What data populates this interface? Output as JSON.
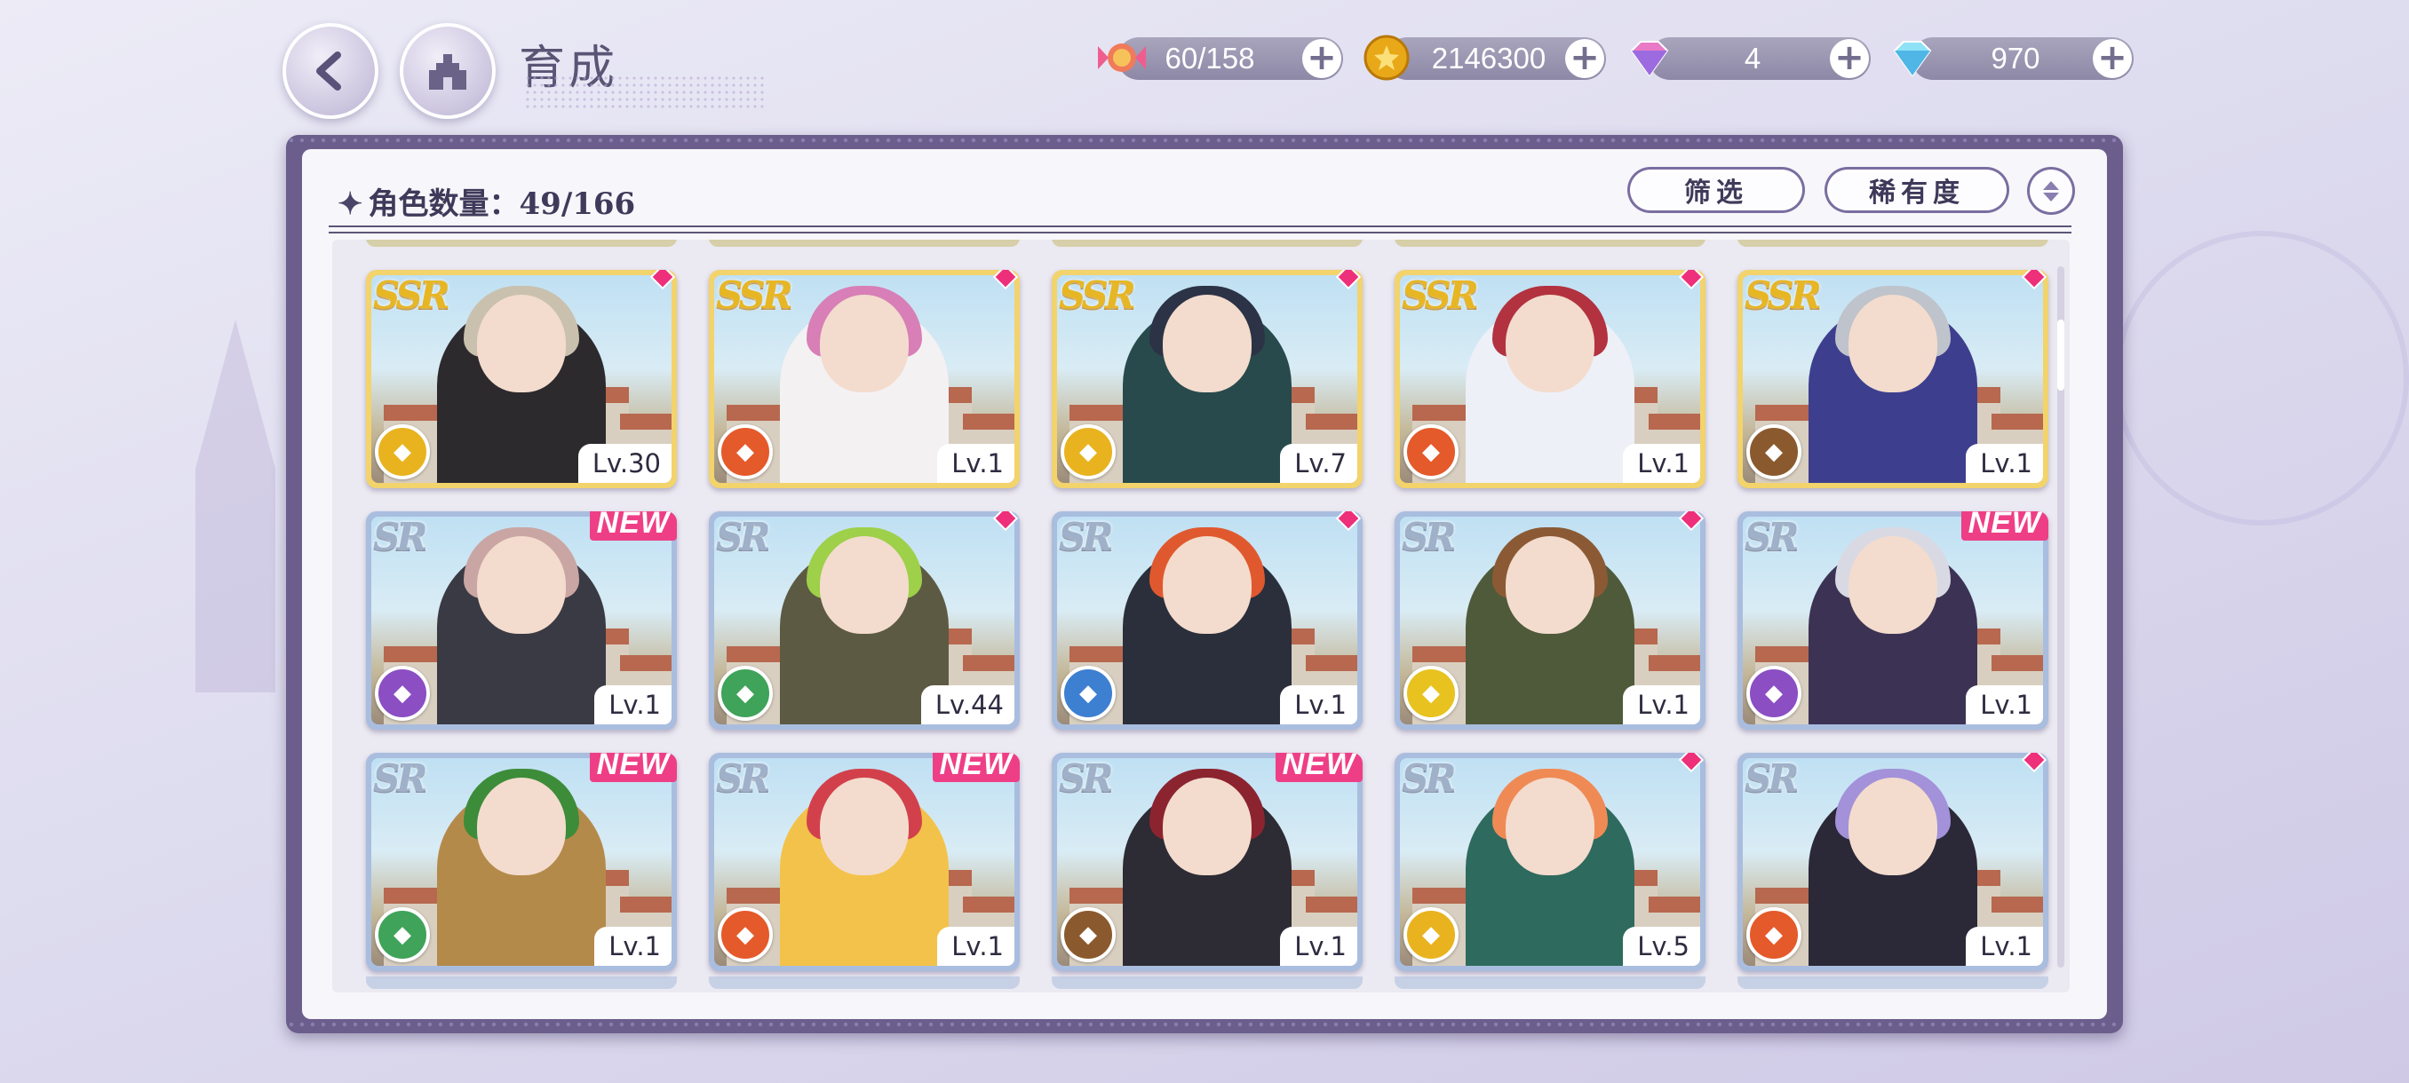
{
  "header": {
    "title": "育成",
    "back_icon": "back-arrow-icon",
    "home_icon": "castle-icon"
  },
  "resources": [
    {
      "name": "stamina",
      "icon": "candy-icon",
      "value": "60/158"
    },
    {
      "name": "gold",
      "icon": "gold-coin-icon",
      "value": "2146300"
    },
    {
      "name": "pink-gem",
      "icon": "pink-diamond-icon",
      "value": "4"
    },
    {
      "name": "blue-gem",
      "icon": "blue-diamond-icon",
      "value": "970"
    }
  ],
  "panel": {
    "count_label": "角色数量：",
    "count_value": "49/166",
    "filter_label": "筛选",
    "sort_label": "稀有度"
  },
  "cards": [
    {
      "rarity": "SSR",
      "level": "Lv.30",
      "element_color": "#e8b31f",
      "badge": "gem",
      "hair": "#c9c1ae",
      "outfit": "#2d2a2e"
    },
    {
      "rarity": "SSR",
      "level": "Lv.1",
      "element_color": "#e45a2a",
      "badge": "gem",
      "hair": "#d77fb6",
      "outfit": "#f4f1f3"
    },
    {
      "rarity": "SSR",
      "level": "Lv.7",
      "element_color": "#e8b31f",
      "badge": "gem",
      "hair": "#2c3346",
      "outfit": "#284a4c"
    },
    {
      "rarity": "SSR",
      "level": "Lv.1",
      "element_color": "#e45a2a",
      "badge": "gem",
      "hair": "#b3323f",
      "outfit": "#eef0f8"
    },
    {
      "rarity": "SSR",
      "level": "Lv.1",
      "element_color": "#8a5a2e",
      "badge": "gem",
      "hair": "#bfc3cb",
      "outfit": "#3d3f8e"
    },
    {
      "rarity": "SR",
      "level": "Lv.1",
      "element_color": "#8b4ec3",
      "badge": "NEW",
      "hair": "#c9a6a3",
      "outfit": "#3a3a44"
    },
    {
      "rarity": "SR",
      "level": "Lv.44",
      "element_color": "#3fa35a",
      "badge": "gem",
      "hair": "#9ed04a",
      "outfit": "#5d5a43"
    },
    {
      "rarity": "SR",
      "level": "Lv.1",
      "element_color": "#3d7fd1",
      "badge": "gem",
      "hair": "#e0592e",
      "outfit": "#2b2f3c"
    },
    {
      "rarity": "SR",
      "level": "Lv.1",
      "element_color": "#e8c21f",
      "badge": "gem",
      "hair": "#8b5a34",
      "outfit": "#4f5a3a"
    },
    {
      "rarity": "SR",
      "level": "Lv.1",
      "element_color": "#8b4ec3",
      "badge": "NEW",
      "hair": "#d9d9e3",
      "outfit": "#3c3354"
    },
    {
      "rarity": "SR",
      "level": "Lv.1",
      "element_color": "#3fa35a",
      "badge": "NEW",
      "hair": "#3d8c3a",
      "outfit": "#b48a4a"
    },
    {
      "rarity": "SR",
      "level": "Lv.1",
      "element_color": "#e45a2a",
      "badge": "NEW",
      "hair": "#d2414b",
      "outfit": "#f3c24a"
    },
    {
      "rarity": "SR",
      "level": "Lv.1",
      "element_color": "#8a5a2e",
      "badge": "NEW",
      "hair": "#8c2430",
      "outfit": "#2d2b33"
    },
    {
      "rarity": "SR",
      "level": "Lv.5",
      "element_color": "#e8b31f",
      "badge": "gem",
      "hair": "#f08a55",
      "outfit": "#2f6a5e"
    },
    {
      "rarity": "SR",
      "level": "Lv.1",
      "element_color": "#e45a2a",
      "badge": "gem",
      "hair": "#a391d9",
      "outfit": "#2b2838"
    }
  ],
  "colors": {
    "frame": "#6b5e8c",
    "new_badge": "#ee3f86",
    "ssr_border": "#f2d36c",
    "sr_border": "#a9bddf"
  }
}
